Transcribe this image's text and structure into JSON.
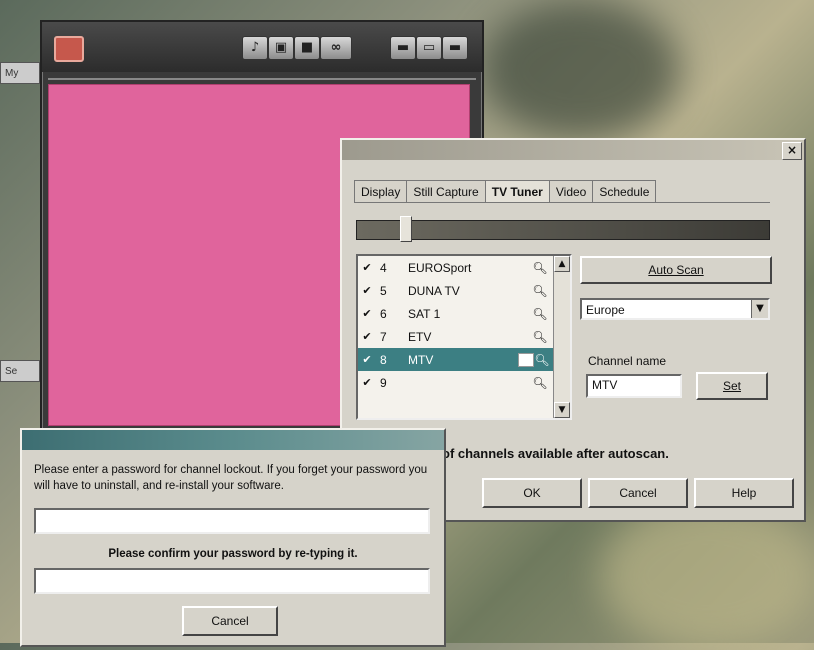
{
  "tv_app": {
    "side_tabs": [
      "My",
      "Se"
    ],
    "toolbar_icons": [
      "note-icon",
      "camera-icon",
      "record-icon",
      "link-icon",
      "minimize-icon",
      "maximize-icon",
      "close-icon"
    ]
  },
  "dialog": {
    "close_glyph": "×",
    "tabs": [
      "Display",
      "Still Capture",
      "TV Tuner",
      "Video",
      "Schedule"
    ],
    "active_tab": "TV Tuner",
    "channels": [
      {
        "checked": true,
        "number": "4",
        "name": "EUROSport",
        "locked": false,
        "selected": false
      },
      {
        "checked": true,
        "number": "5",
        "name": "DUNA TV",
        "locked": false,
        "selected": false
      },
      {
        "checked": true,
        "number": "6",
        "name": "SAT 1",
        "locked": false,
        "selected": false
      },
      {
        "checked": true,
        "number": "7",
        "name": "ETV",
        "locked": false,
        "selected": false
      },
      {
        "checked": true,
        "number": "8",
        "name": "MTV",
        "locked": true,
        "selected": true
      },
      {
        "checked": true,
        "number": "9",
        "name": "",
        "locked": false,
        "selected": false
      }
    ],
    "auto_scan_label": "Auto Scan",
    "region_value": "Europe",
    "channel_name_label": "Channel name",
    "channel_name_value": "MTV",
    "set_label": "Set",
    "autoscan_note": "of channels available after autoscan.",
    "ok_label": "OK",
    "cancel_label": "Cancel",
    "help_label": "Help"
  },
  "password_dialog": {
    "message": "Please enter a password for channel lockout. If you forget your password you will have to uninstall, and re-install your software.",
    "password_value": "",
    "confirm_text": "Please confirm your password by re-typing it.",
    "confirm_value": "",
    "cancel_label": "Cancel"
  }
}
